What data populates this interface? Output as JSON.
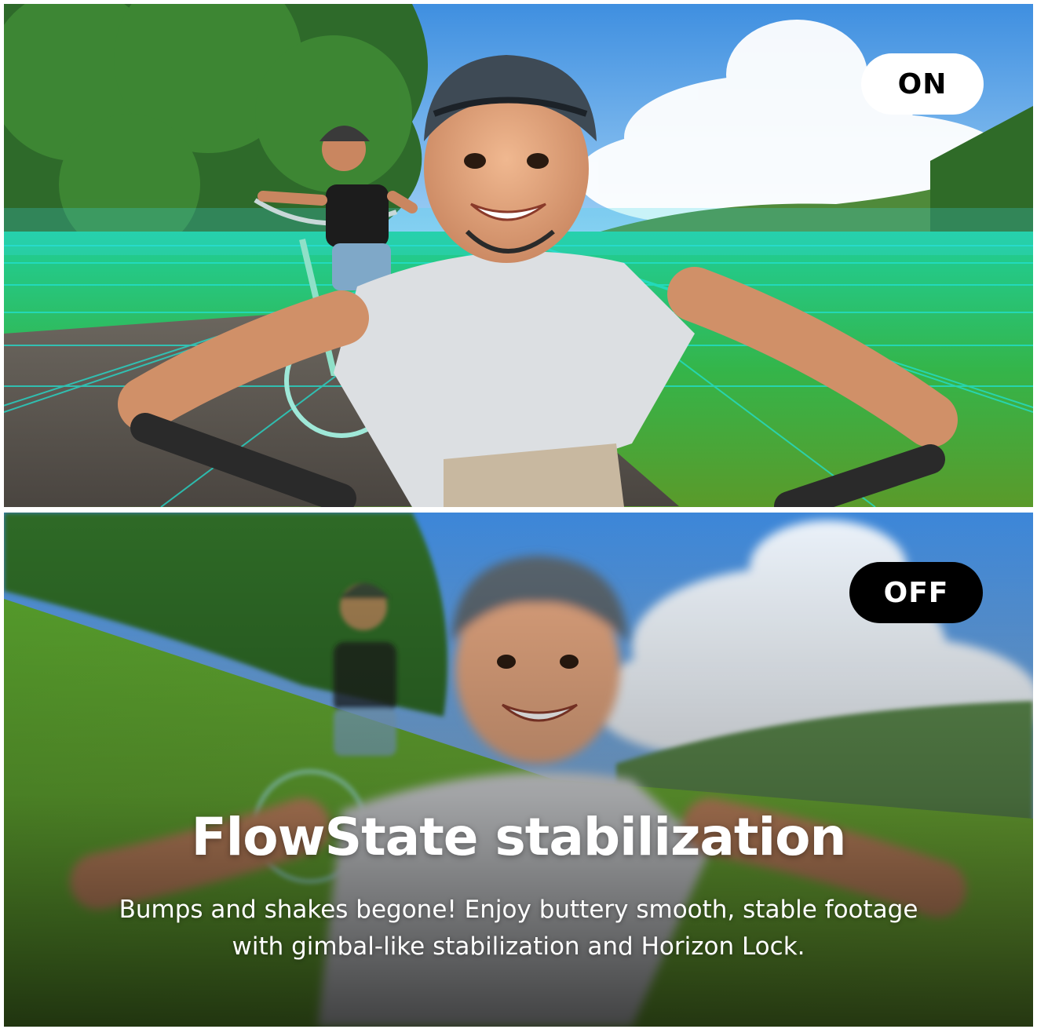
{
  "panels": {
    "top": {
      "toggle_label": "ON"
    },
    "bottom": {
      "toggle_label": "OFF"
    }
  },
  "caption": {
    "title": "FlowState stabilization",
    "body_line_1": "Bumps and shakes begone! Enjoy buttery smooth, stable footage",
    "body_line_2": "with gimbal-like stabilization and Horizon Lock."
  },
  "colors": {
    "on_pill_bg": "#ffffff",
    "off_pill_bg": "#000000",
    "horizon_grid": "#22e0d0"
  }
}
